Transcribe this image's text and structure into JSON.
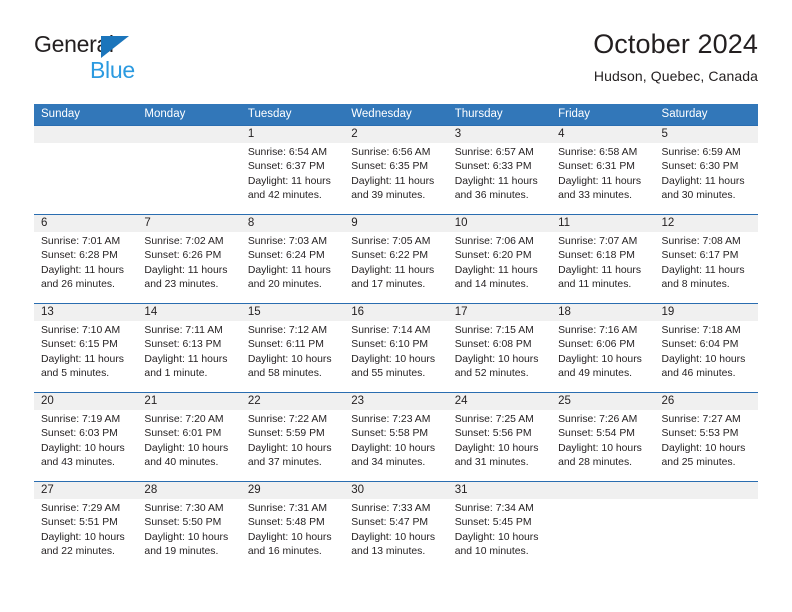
{
  "brand": {
    "name_top": "General",
    "name_bottom": "Blue",
    "accent_color": "#1b75bb",
    "accent_light": "#2b9ae0"
  },
  "header": {
    "title": "October 2024",
    "location": "Hudson, Quebec, Canada"
  },
  "theme": {
    "header_blue": "#3277b9",
    "row_divider_blue": "#2a6db0",
    "daynum_band": "#f0f0f0",
    "text": "#231f20"
  },
  "weekday_headers": [
    "Sunday",
    "Monday",
    "Tuesday",
    "Wednesday",
    "Thursday",
    "Friday",
    "Saturday"
  ],
  "labels": {
    "sunrise_prefix": "Sunrise: ",
    "sunset_prefix": "Sunset: ",
    "daylight_prefix": "Daylight: "
  },
  "weeks": [
    [
      {
        "day": "",
        "sunrise": "",
        "sunset": "",
        "daylight_line1": "",
        "daylight_line2": ""
      },
      {
        "day": "",
        "sunrise": "",
        "sunset": "",
        "daylight_line1": "",
        "daylight_line2": ""
      },
      {
        "day": "1",
        "sunrise": "Sunrise: 6:54 AM",
        "sunset": "Sunset: 6:37 PM",
        "daylight_line1": "Daylight: 11 hours",
        "daylight_line2": "and 42 minutes."
      },
      {
        "day": "2",
        "sunrise": "Sunrise: 6:56 AM",
        "sunset": "Sunset: 6:35 PM",
        "daylight_line1": "Daylight: 11 hours",
        "daylight_line2": "and 39 minutes."
      },
      {
        "day": "3",
        "sunrise": "Sunrise: 6:57 AM",
        "sunset": "Sunset: 6:33 PM",
        "daylight_line1": "Daylight: 11 hours",
        "daylight_line2": "and 36 minutes."
      },
      {
        "day": "4",
        "sunrise": "Sunrise: 6:58 AM",
        "sunset": "Sunset: 6:31 PM",
        "daylight_line1": "Daylight: 11 hours",
        "daylight_line2": "and 33 minutes."
      },
      {
        "day": "5",
        "sunrise": "Sunrise: 6:59 AM",
        "sunset": "Sunset: 6:30 PM",
        "daylight_line1": "Daylight: 11 hours",
        "daylight_line2": "and 30 minutes."
      }
    ],
    [
      {
        "day": "6",
        "sunrise": "Sunrise: 7:01 AM",
        "sunset": "Sunset: 6:28 PM",
        "daylight_line1": "Daylight: 11 hours",
        "daylight_line2": "and 26 minutes."
      },
      {
        "day": "7",
        "sunrise": "Sunrise: 7:02 AM",
        "sunset": "Sunset: 6:26 PM",
        "daylight_line1": "Daylight: 11 hours",
        "daylight_line2": "and 23 minutes."
      },
      {
        "day": "8",
        "sunrise": "Sunrise: 7:03 AM",
        "sunset": "Sunset: 6:24 PM",
        "daylight_line1": "Daylight: 11 hours",
        "daylight_line2": "and 20 minutes."
      },
      {
        "day": "9",
        "sunrise": "Sunrise: 7:05 AM",
        "sunset": "Sunset: 6:22 PM",
        "daylight_line1": "Daylight: 11 hours",
        "daylight_line2": "and 17 minutes."
      },
      {
        "day": "10",
        "sunrise": "Sunrise: 7:06 AM",
        "sunset": "Sunset: 6:20 PM",
        "daylight_line1": "Daylight: 11 hours",
        "daylight_line2": "and 14 minutes."
      },
      {
        "day": "11",
        "sunrise": "Sunrise: 7:07 AM",
        "sunset": "Sunset: 6:18 PM",
        "daylight_line1": "Daylight: 11 hours",
        "daylight_line2": "and 11 minutes."
      },
      {
        "day": "12",
        "sunrise": "Sunrise: 7:08 AM",
        "sunset": "Sunset: 6:17 PM",
        "daylight_line1": "Daylight: 11 hours",
        "daylight_line2": "and 8 minutes."
      }
    ],
    [
      {
        "day": "13",
        "sunrise": "Sunrise: 7:10 AM",
        "sunset": "Sunset: 6:15 PM",
        "daylight_line1": "Daylight: 11 hours",
        "daylight_line2": "and 5 minutes."
      },
      {
        "day": "14",
        "sunrise": "Sunrise: 7:11 AM",
        "sunset": "Sunset: 6:13 PM",
        "daylight_line1": "Daylight: 11 hours",
        "daylight_line2": "and 1 minute."
      },
      {
        "day": "15",
        "sunrise": "Sunrise: 7:12 AM",
        "sunset": "Sunset: 6:11 PM",
        "daylight_line1": "Daylight: 10 hours",
        "daylight_line2": "and 58 minutes."
      },
      {
        "day": "16",
        "sunrise": "Sunrise: 7:14 AM",
        "sunset": "Sunset: 6:10 PM",
        "daylight_line1": "Daylight: 10 hours",
        "daylight_line2": "and 55 minutes."
      },
      {
        "day": "17",
        "sunrise": "Sunrise: 7:15 AM",
        "sunset": "Sunset: 6:08 PM",
        "daylight_line1": "Daylight: 10 hours",
        "daylight_line2": "and 52 minutes."
      },
      {
        "day": "18",
        "sunrise": "Sunrise: 7:16 AM",
        "sunset": "Sunset: 6:06 PM",
        "daylight_line1": "Daylight: 10 hours",
        "daylight_line2": "and 49 minutes."
      },
      {
        "day": "19",
        "sunrise": "Sunrise: 7:18 AM",
        "sunset": "Sunset: 6:04 PM",
        "daylight_line1": "Daylight: 10 hours",
        "daylight_line2": "and 46 minutes."
      }
    ],
    [
      {
        "day": "20",
        "sunrise": "Sunrise: 7:19 AM",
        "sunset": "Sunset: 6:03 PM",
        "daylight_line1": "Daylight: 10 hours",
        "daylight_line2": "and 43 minutes."
      },
      {
        "day": "21",
        "sunrise": "Sunrise: 7:20 AM",
        "sunset": "Sunset: 6:01 PM",
        "daylight_line1": "Daylight: 10 hours",
        "daylight_line2": "and 40 minutes."
      },
      {
        "day": "22",
        "sunrise": "Sunrise: 7:22 AM",
        "sunset": "Sunset: 5:59 PM",
        "daylight_line1": "Daylight: 10 hours",
        "daylight_line2": "and 37 minutes."
      },
      {
        "day": "23",
        "sunrise": "Sunrise: 7:23 AM",
        "sunset": "Sunset: 5:58 PM",
        "daylight_line1": "Daylight: 10 hours",
        "daylight_line2": "and 34 minutes."
      },
      {
        "day": "24",
        "sunrise": "Sunrise: 7:25 AM",
        "sunset": "Sunset: 5:56 PM",
        "daylight_line1": "Daylight: 10 hours",
        "daylight_line2": "and 31 minutes."
      },
      {
        "day": "25",
        "sunrise": "Sunrise: 7:26 AM",
        "sunset": "Sunset: 5:54 PM",
        "daylight_line1": "Daylight: 10 hours",
        "daylight_line2": "and 28 minutes."
      },
      {
        "day": "26",
        "sunrise": "Sunrise: 7:27 AM",
        "sunset": "Sunset: 5:53 PM",
        "daylight_line1": "Daylight: 10 hours",
        "daylight_line2": "and 25 minutes."
      }
    ],
    [
      {
        "day": "27",
        "sunrise": "Sunrise: 7:29 AM",
        "sunset": "Sunset: 5:51 PM",
        "daylight_line1": "Daylight: 10 hours",
        "daylight_line2": "and 22 minutes."
      },
      {
        "day": "28",
        "sunrise": "Sunrise: 7:30 AM",
        "sunset": "Sunset: 5:50 PM",
        "daylight_line1": "Daylight: 10 hours",
        "daylight_line2": "and 19 minutes."
      },
      {
        "day": "29",
        "sunrise": "Sunrise: 7:31 AM",
        "sunset": "Sunset: 5:48 PM",
        "daylight_line1": "Daylight: 10 hours",
        "daylight_line2": "and 16 minutes."
      },
      {
        "day": "30",
        "sunrise": "Sunrise: 7:33 AM",
        "sunset": "Sunset: 5:47 PM",
        "daylight_line1": "Daylight: 10 hours",
        "daylight_line2": "and 13 minutes."
      },
      {
        "day": "31",
        "sunrise": "Sunrise: 7:34 AM",
        "sunset": "Sunset: 5:45 PM",
        "daylight_line1": "Daylight: 10 hours",
        "daylight_line2": "and 10 minutes."
      },
      {
        "day": "",
        "sunrise": "",
        "sunset": "",
        "daylight_line1": "",
        "daylight_line2": ""
      },
      {
        "day": "",
        "sunrise": "",
        "sunset": "",
        "daylight_line1": "",
        "daylight_line2": ""
      }
    ]
  ]
}
